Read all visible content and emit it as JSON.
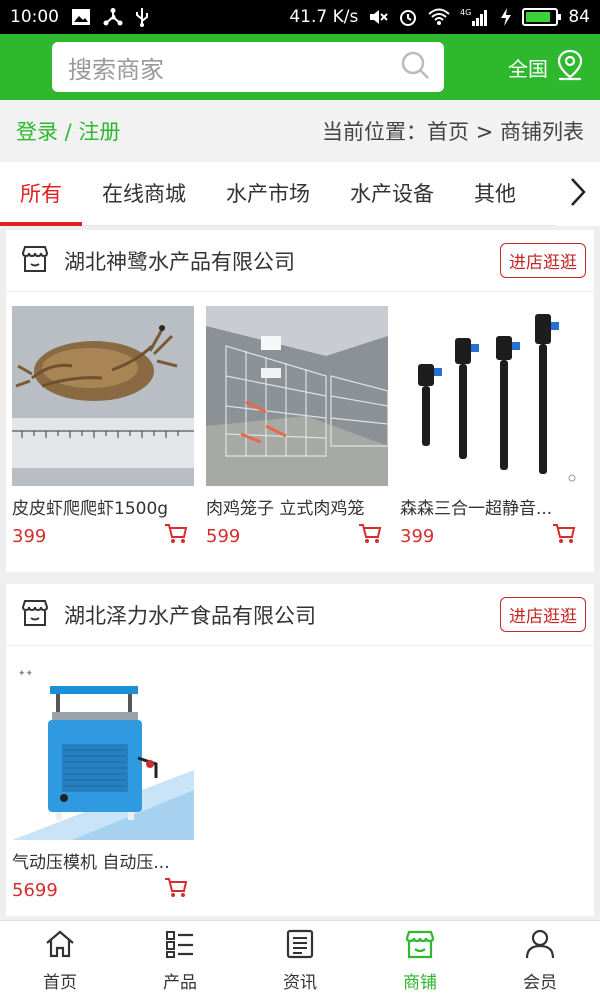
{
  "status_bar": {
    "time": "10:00",
    "speed": "41.7 K/s",
    "network": "4G",
    "battery": "84",
    "battery_level_percent": 84
  },
  "header": {
    "search_placeholder": "搜索商家",
    "region": "全国"
  },
  "breadcrumb": {
    "login": "登录 / 注册",
    "location": "当前位置：首页 > 商铺列表"
  },
  "tabs": [
    {
      "label": "所有",
      "active": true
    },
    {
      "label": "在线商城"
    },
    {
      "label": "水产市场"
    },
    {
      "label": "水产设备"
    },
    {
      "label": "其他"
    }
  ],
  "shops": [
    {
      "name": "湖北神鹭水产品有限公司",
      "enter_label": "进店逛逛",
      "products": [
        {
          "name": "皮皮虾爬爬虾1500g",
          "price": "399",
          "image": "mantis-shrimp-photo"
        },
        {
          "name": "肉鸡笼子 立式肉鸡笼",
          "price": "599",
          "image": "chicken-cage-photo"
        },
        {
          "name": "森森三合一超静音...",
          "price": "399",
          "image": "aquarium-pump-photo"
        }
      ]
    },
    {
      "name": "湖北泽力水产食品有限公司",
      "enter_label": "进店逛逛",
      "products": [
        {
          "name": "气动压模机 自动压...",
          "price": "5699",
          "image": "press-machine-photo"
        }
      ]
    }
  ],
  "bottom_nav": [
    {
      "label": "首页",
      "icon": "home-icon"
    },
    {
      "label": "产品",
      "icon": "list-icon"
    },
    {
      "label": "资讯",
      "icon": "news-icon"
    },
    {
      "label": "商铺",
      "icon": "shop-icon",
      "active": true
    },
    {
      "label": "会员",
      "icon": "user-icon"
    }
  ],
  "colors": {
    "brand_green": "#2eb82e",
    "accent_red": "#e32020",
    "price_red": "#d62d2d"
  }
}
